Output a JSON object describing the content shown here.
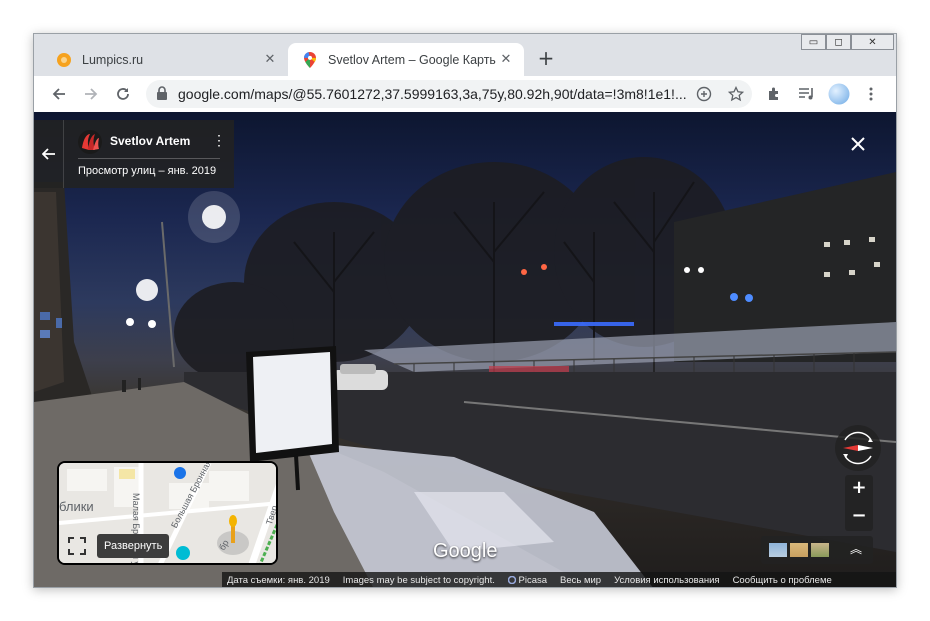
{
  "window": {
    "controls": {
      "minimize": "▭",
      "maximize": "◻",
      "close": "✕"
    }
  },
  "tabs": [
    {
      "title": "Lumpics.ru",
      "favicon": "lumpics-orange-circle",
      "active": false,
      "close": "✕"
    },
    {
      "title": "Svetlov Artem – Google Карты",
      "favicon": "google-maps-pin",
      "active": true,
      "close": "✕"
    }
  ],
  "new_tab": "+",
  "toolbar": {
    "url": "google.com/maps/@55.7601272,37.5999163,3a,75y,80.92h,90t/data=!3m8!1e1!..."
  },
  "street_view": {
    "owner_name": "Svetlov Artem",
    "view_label": "Просмотр улиц – янв. 2019",
    "menu": "⋮",
    "minimap": {
      "label_place": "блики",
      "street_a": "Малая Бронная ул.",
      "street_b": "Большая Бронная ул.",
      "street_c": "Твер",
      "street_d": "бр",
      "expand_tooltip": "Развернуть"
    },
    "logo": "Google",
    "zoom_in": "+",
    "zoom_out": "−",
    "expand_thumbs": "︽"
  },
  "footer": {
    "capture_date": "Дата съемки: янв. 2019",
    "copyright": "Images may be subject to copyright.",
    "picasa": "Picasa",
    "region": "Весь мир",
    "terms": "Условия использования",
    "report": "Сообщить о проблеме"
  },
  "colors": {
    "tab_strip": "#dee1e6",
    "omnibox": "#f1f3f4",
    "overlay": "#222222",
    "compass_red": "#e53935",
    "lumpics": "#f6a21e"
  }
}
